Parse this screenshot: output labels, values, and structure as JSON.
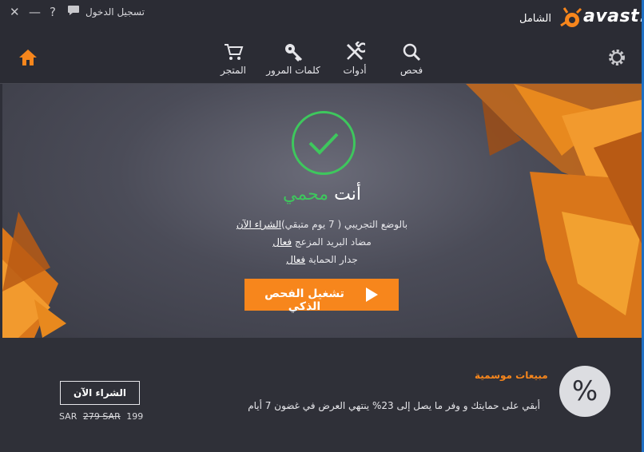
{
  "titlebar": {
    "login_label": "تسجيل الدخول",
    "help_label": "?",
    "close_label": "✕",
    "minimize_label": "—",
    "edition": "الشامل",
    "brand": "avast!"
  },
  "nav": {
    "items": [
      {
        "label": "المتجر",
        "icon": "cart-icon"
      },
      {
        "label": "كلمات المرور",
        "icon": "key-icon"
      },
      {
        "label": "أدوات",
        "icon": "tools-icon"
      },
      {
        "label": "فحص",
        "icon": "search-icon"
      }
    ]
  },
  "status": {
    "prefix": "أنت",
    "state": "محمي"
  },
  "info": {
    "trial_text": "بالوضع التجريبي ( 7 يوم متبقي)",
    "trial_link": "الشراء  الآن",
    "antispam_label": "مضاد البريد المزعج",
    "antispam_value": "فعال",
    "firewall_label": "جدار الحماية",
    "firewall_value": "فعال"
  },
  "scan_button": {
    "label": "تشغيل الفحص الذكي"
  },
  "promo": {
    "title": "مبيعات موسمية",
    "text": "أبقي على حمايتك و وفر ما يصل إلى 23%  ينتهي العرض في غضون 7 أيام",
    "percent_symbol": "%",
    "buy_label": "الشراء الآن",
    "old_price": "279 SAR",
    "new_price": "199",
    "currency": "SAR"
  },
  "colors": {
    "accent": "#f7861c",
    "success": "#3ec75d",
    "background": "#2e2f38"
  }
}
